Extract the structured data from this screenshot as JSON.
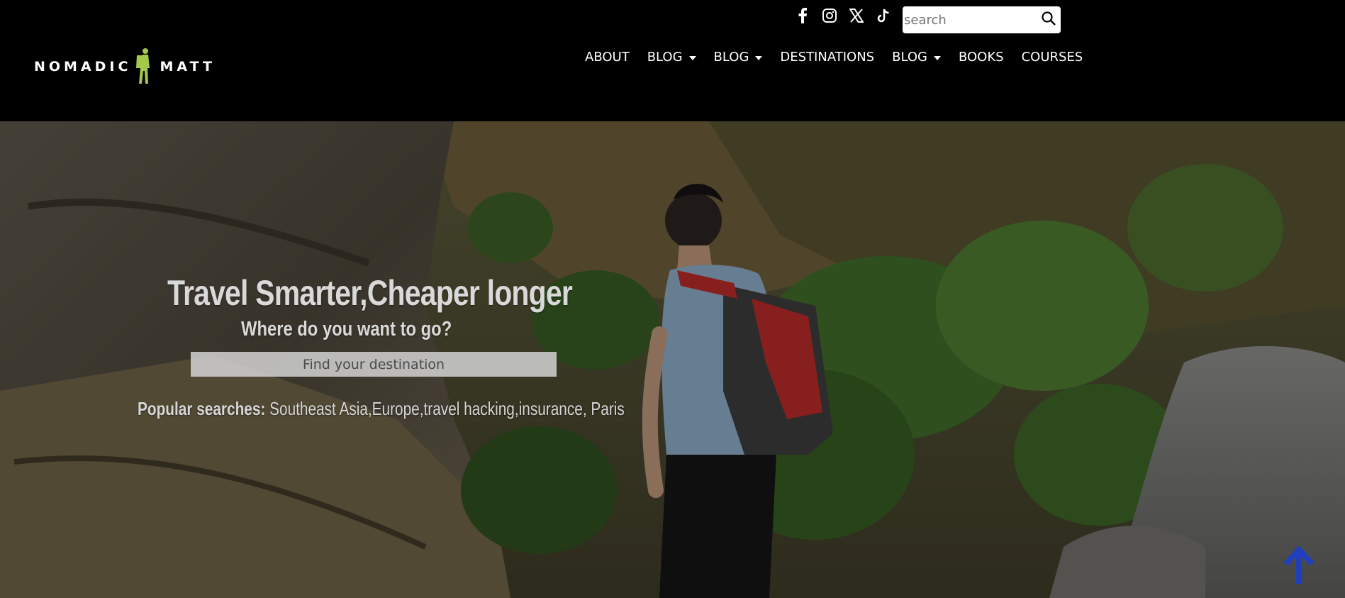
{
  "brand": {
    "logo_left": "NOMADIC",
    "logo_right": "MATT",
    "accent": "#a3c94a"
  },
  "social": [
    {
      "icon": "facebook-icon"
    },
    {
      "icon": "instagram-icon"
    },
    {
      "icon": "x-twitter-icon"
    },
    {
      "icon": "tiktok-icon"
    }
  ],
  "header_search": {
    "placeholder": "search"
  },
  "nav": {
    "items": [
      {
        "label": "ABOUT"
      },
      {
        "label": "BLOG"
      },
      {
        "label": "BLOG"
      },
      {
        "label": "DESTINATIONS"
      },
      {
        "label": "BLOG"
      },
      {
        "label": "BOOKS"
      },
      {
        "label": "COURSES"
      }
    ]
  },
  "hero": {
    "headline": "Travel Smarter,Cheaper longer",
    "subheadline": "Where do you want to go?",
    "destination_placeholder": "Find your destination",
    "popular_label": "Popular searches:",
    "popular_links": "Southeast Asia,Europe,travel hacking,insurance, Paris"
  },
  "colors": {
    "header_bg": "#000000",
    "back_to_top": "#1f3fbf"
  }
}
